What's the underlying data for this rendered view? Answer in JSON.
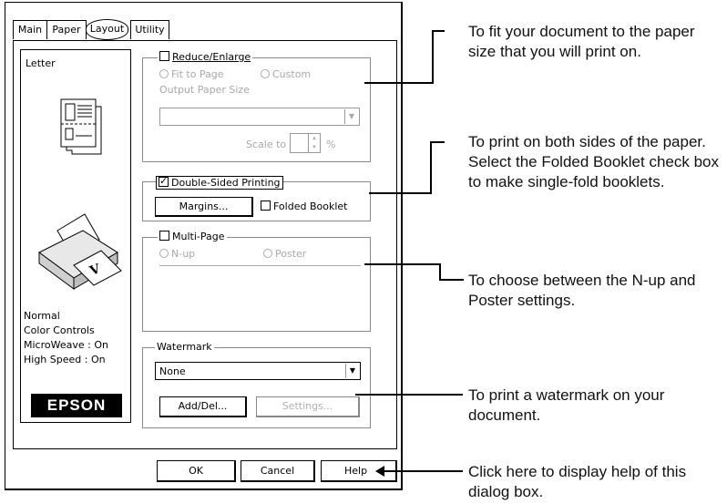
{
  "tabs": [
    {
      "label": "Main"
    },
    {
      "label": "Paper"
    },
    {
      "label": "Layout"
    },
    {
      "label": "Utility"
    }
  ],
  "preview": {
    "paper_label": "Letter",
    "status_lines": [
      "Normal",
      "Color Controls",
      "MicroWeave : On",
      "High Speed : On"
    ],
    "logo_text": "EPSON"
  },
  "reduce_enlarge": {
    "label": "Reduce/Enlarge",
    "checked": false,
    "fit_to_page": "Fit to Page",
    "custom": "Custom",
    "output_paper_size": "Output Paper Size",
    "output_value": "",
    "scale_to": "Scale to",
    "scale_unit": "%"
  },
  "double_sided": {
    "label": "Double-Sided Printing",
    "checked": true,
    "margins_button": "Margins...",
    "folded_booklet": "Folded Booklet",
    "folded_checked": false
  },
  "multi_page": {
    "label": "Multi-Page",
    "checked": false,
    "n_up": "N-up",
    "poster": "Poster"
  },
  "watermark": {
    "label": "Watermark",
    "value": "None",
    "add_del_button": "Add/Del...",
    "settings_button": "Settings..."
  },
  "footer": {
    "ok": "OK",
    "cancel": "Cancel",
    "help": "Help"
  },
  "callouts": [
    "To fit your document to the paper size that you will print on.",
    "To print on both sides of the paper. Select the Folded Booklet check box to make single-fold booklets.",
    "To choose between the N-up and Poster settings.",
    "To print a watermark on your document.",
    "Click here to display help of this dialog box."
  ]
}
